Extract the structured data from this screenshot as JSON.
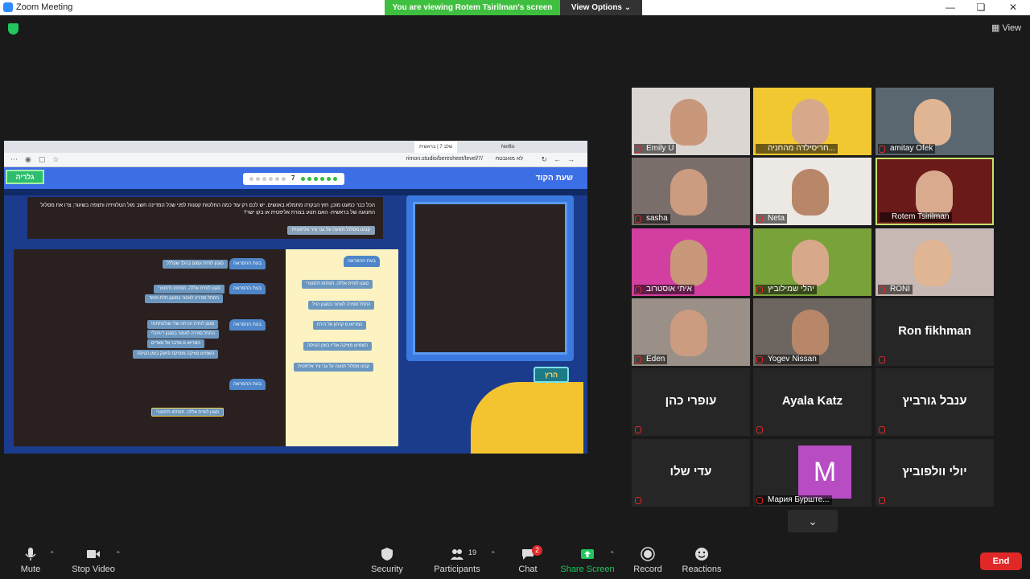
{
  "window": {
    "title": "Zoom Meeting"
  },
  "share_banner": {
    "viewing": "You are viewing Rotem Tsirilman's screen",
    "view_options": "View Options"
  },
  "view_label": "View",
  "shared": {
    "tabs": [
      "Netflix",
      "שלב 7 | בראשית"
    ],
    "url": "rimon.studio/beresheet/level/7/",
    "private_label": "לא מאובטח",
    "game_title": "שעת הקוד",
    "level": "7",
    "menu_label": "גלריה",
    "instruction": "הכל כבר כמעט מוכן, חוץ הבקרה מתמלא באנשים. יש לכם רק עוד כמה החלטות קטנות לפני שכל המדינה חשב מול הטלוויזיה ותצפה בשיגור; צרו את מסלול התנועה של בראשית- האם תנוע בצורת אליפטית או בקו ישר?",
    "instruction_block": "קבעו מסלול תנועה על גבי ציר אליפטית",
    "run_label": "הרץ",
    "workspace_blocks": [
      "בעת ההפראה",
      "סגנון לוחית עמום בהלך שקללל",
      "בעת ההפראה",
      "סגנון לוחית אללה, תפתחו ת'סטורי",
      "התחל ספירה לאחור בסגנון תלת מימד",
      "בעת ההפראה",
      "סגנון לוחית הכיתה שלי שולטתתת!",
      "התחל ספירה לאחור בסגנון דיגיטלי",
      "המריאו מ מדבר אל מאדים",
      "השמיעו מוזיקה מוסיקת פ'אנק בזמן הטיסה",
      "בעת ההפראה",
      "סגנון לוחית אללה, תפתחו ת'סטורי"
    ],
    "toolbox_blocks": [
      "בעת ההפראה",
      "סגנון לוחית אללה, תפתחו ת'סטורי",
      "התחל ספירה לאחור בסגנון רגיל",
      "המריאו מ קרחון אל הירח",
      "השמיעו מוזיקה אודיו בזמן הטיסה",
      "קבעו מסלול תנועה על גבי ציר אליפטית"
    ]
  },
  "participants": [
    {
      "name": "Emily U",
      "video": true,
      "muted": true
    },
    {
      "name": "חריסילדה מהחניה...",
      "video": true,
      "muted": false
    },
    {
      "name": "amitay Ofek",
      "video": true,
      "muted": true
    },
    {
      "name": "sasha",
      "video": true,
      "muted": true
    },
    {
      "name": "Neta",
      "video": true,
      "muted": true
    },
    {
      "name": "Rotem Tsirilman",
      "video": true,
      "muted": false
    },
    {
      "name": "איתי אוסטרוב",
      "video": true,
      "muted": true
    },
    {
      "name": "יהלי שמילוביץ",
      "video": true,
      "muted": true
    },
    {
      "name": "RONI",
      "video": true,
      "muted": true
    },
    {
      "name": "Eden",
      "video": true,
      "muted": true
    },
    {
      "name": "Yogev Nissan",
      "video": true,
      "muted": true
    },
    {
      "name": "Ron fikhman",
      "video": false,
      "muted": true
    },
    {
      "name": "עופרי כהן",
      "video": false,
      "muted": true
    },
    {
      "name": "Ayala Katz",
      "video": false,
      "muted": true
    },
    {
      "name": "ענבל גורביץ",
      "video": false,
      "muted": true
    },
    {
      "name": "עדי שלו",
      "video": false,
      "muted": true
    },
    {
      "name": "Мария Бурште...",
      "video": false,
      "muted": true,
      "avatar": "M"
    },
    {
      "name": "יולי וולפוביץ",
      "video": false,
      "muted": true
    }
  ],
  "toolbar": {
    "mute": "Mute",
    "stop_video": "Stop Video",
    "security": "Security",
    "participants": "Participants",
    "participants_count": "19",
    "chat": "Chat",
    "chat_badge": "2",
    "share_screen": "Share Screen",
    "record": "Record",
    "reactions": "Reactions",
    "end": "End"
  },
  "colors": {
    "accent_green": "#3fbf3f",
    "end_red": "#e02828",
    "active_speaker": "#c7e36a"
  }
}
